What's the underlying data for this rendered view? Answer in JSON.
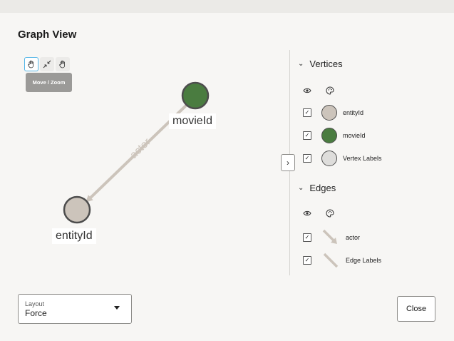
{
  "dialog": {
    "title": "Graph View"
  },
  "toolbar": {
    "tools": [
      {
        "icon": "hand-icon",
        "active": true
      },
      {
        "icon": "shrink-icon",
        "active": false
      },
      {
        "icon": "hand-icon",
        "active": false
      }
    ],
    "tooltip": "Move / Zoom"
  },
  "graph": {
    "nodes": [
      {
        "label": "movieId",
        "color": "#4a7c40"
      },
      {
        "label": "entityId",
        "color": "#ccc4bb"
      }
    ],
    "edge": {
      "label": "actor",
      "color": "#ccc4bb"
    }
  },
  "legend": {
    "vertices": {
      "heading": "Vertices",
      "items": [
        {
          "label": "entityId",
          "color": "#ccc4bb",
          "checked": true
        },
        {
          "label": "movieId",
          "color": "#4a7c40",
          "checked": true
        },
        {
          "label": "Vertex Labels",
          "color": "#dedddb",
          "checked": true
        }
      ]
    },
    "edges": {
      "heading": "Edges",
      "items": [
        {
          "label": "actor",
          "color": "#ccc4bb",
          "checked": true
        },
        {
          "label": "Edge Labels",
          "color": "#ccc4bb",
          "checked": true
        }
      ]
    },
    "icons": [
      "eye-icon",
      "palette-icon"
    ]
  },
  "footer": {
    "layout_caption": "Layout",
    "layout_value": "Force",
    "close_label": "Close"
  }
}
